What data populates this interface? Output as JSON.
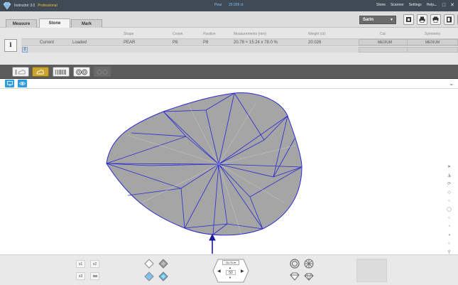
{
  "titlebar": {
    "app_name": "Instructor 3.0",
    "edition": "Professional",
    "center_left": "Pear",
    "center_right": "20.026 ct",
    "menu": [
      "Stone",
      "Scanner",
      "Settings",
      "Help"
    ],
    "window_controls": [
      "minimize-icon",
      "maximize-icon",
      "close-icon"
    ]
  },
  "tabs": [
    {
      "label": "Measure",
      "active": false
    },
    {
      "label": "Stone",
      "active": true
    },
    {
      "label": "Mark",
      "active": false
    }
  ],
  "device_select": {
    "value": "Sarin"
  },
  "toolbar_icons": [
    "bookmark-icon",
    "print-icon",
    "print-report-icon",
    "export-icon",
    "back-icon"
  ],
  "info": {
    "headers": {
      "shape": "Shape",
      "crown": "Crown",
      "pavilion": "Pavilion",
      "measurements": "Measurements (mm)",
      "weight": "Weight (ct)",
      "cut": "Cut",
      "symmetry": "Symmetry"
    },
    "row": {
      "label": "Current",
      "status": "Loaded",
      "shape": "PEAR",
      "crown": "P8",
      "pavilion": "P8",
      "measurements": "20.78 × 15.24 x 78.0 %",
      "weight": "20.026",
      "cut": "MEDIUM",
      "symmetry": "MEDIUM"
    },
    "index": "0"
  },
  "view_modes": [
    {
      "name": "outline-view",
      "active": false
    },
    {
      "name": "solid-view",
      "active": true
    },
    {
      "name": "barcode-view",
      "active": false
    },
    {
      "name": "facets-view",
      "active": false
    },
    {
      "name": "settings-view",
      "active": false
    }
  ],
  "zoom": {
    "buttons": [
      "x1",
      "x2",
      "x3",
      ""
    ],
    "goto_label": "Go To",
    "value": "50"
  },
  "colors": {
    "accent": "#2e9de0",
    "active_mode": "#c9a530",
    "facet_line": "#2a2ad0",
    "stone_fill": "#a5a5a5"
  }
}
